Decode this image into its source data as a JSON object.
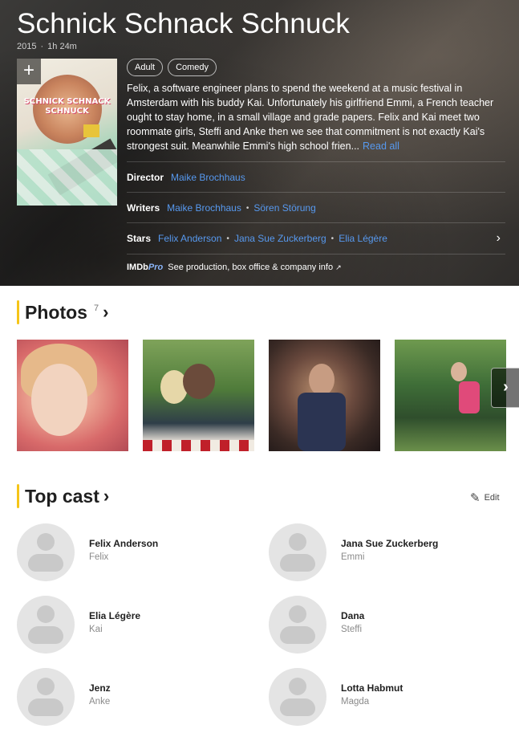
{
  "title": "Schnick Schnack Schnuck",
  "meta": {
    "year": "2015",
    "runtime": "1h 24m"
  },
  "poster": {
    "title_text": "SCHNICK SCHNACK SCHNUCK"
  },
  "genres": [
    "Adult",
    "Comedy"
  ],
  "plot": {
    "text": "Felix, a software engineer plans to spend the weekend at a music festival in Amsterdam with his buddy Kai. Unfortunately his girlfriend Emmi, a French teacher ought to stay home, in a small village and grade papers. Felix and Kai meet two roommate girls, Steffi and Anke then we see that commitment is not exactly Kai's strongest suit. Meanwhile Emmi's high school frien...",
    "read_all": "Read all"
  },
  "credits": {
    "director_label": "Director",
    "directors": [
      "Maike Brochhaus"
    ],
    "writers_label": "Writers",
    "writers": [
      "Maike Brochhaus",
      "Sören Störung"
    ],
    "stars_label": "Stars",
    "stars": [
      "Felix Anderson",
      "Jana Sue Zuckerberg",
      "Elia Légère"
    ]
  },
  "imdbpro": {
    "logo_a": "IMDb",
    "logo_b": "Pro",
    "text": "See production, box office & company info"
  },
  "photos": {
    "heading": "Photos",
    "count": "7"
  },
  "top_cast": {
    "heading": "Top cast",
    "edit_label": "Edit",
    "members": [
      {
        "name": "Felix Anderson",
        "role": "Felix"
      },
      {
        "name": "Jana Sue Zuckerberg",
        "role": "Emmi"
      },
      {
        "name": "Elia Légère",
        "role": "Kai"
      },
      {
        "name": "Dana",
        "role": "Steffi"
      },
      {
        "name": "Jenz",
        "role": "Anke"
      },
      {
        "name": "Lotta Habmut",
        "role": "Magda"
      }
    ]
  },
  "colors": {
    "accent": "#f5c518",
    "link": "#5799ef"
  }
}
